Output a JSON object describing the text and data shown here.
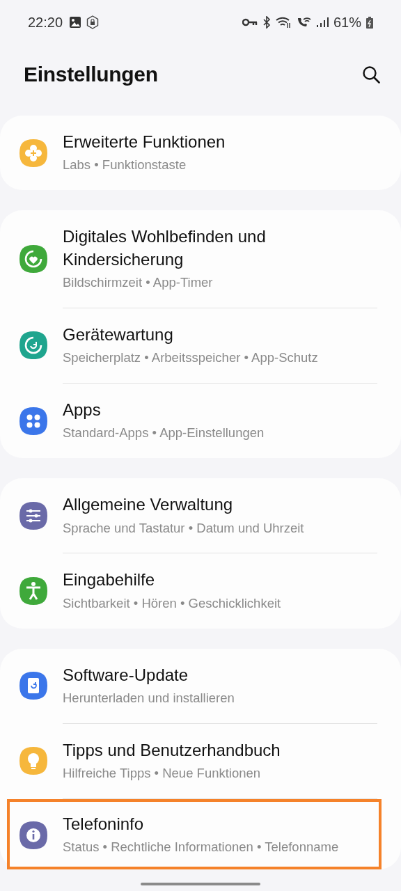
{
  "status_bar": {
    "time": "22:20",
    "battery": "61%"
  },
  "title": "Einstellungen",
  "groups": [
    {
      "items": [
        {
          "kind": "labs",
          "title": "Erweiterte Funktionen",
          "subtitle": "Labs • Funktionstaste",
          "highlighted": false
        }
      ]
    },
    {
      "items": [
        {
          "kind": "wellbeing",
          "title": "Digitales Wohlbefinden und Kindersicherung",
          "subtitle": "Bildschirmzeit • App-Timer",
          "highlighted": false
        },
        {
          "kind": "care",
          "title": "Gerätewartung",
          "subtitle": "Speicherplatz • Arbeitsspeicher • App-Schutz",
          "highlighted": false
        },
        {
          "kind": "apps",
          "title": "Apps",
          "subtitle": "Standard-Apps • App-Einstellungen",
          "highlighted": false
        }
      ]
    },
    {
      "items": [
        {
          "kind": "general",
          "title": "Allgemeine Verwaltung",
          "subtitle": "Sprache und Tastatur • Datum und Uhrzeit",
          "highlighted": false
        },
        {
          "kind": "accessibility",
          "title": "Eingabehilfe",
          "subtitle": "Sichtbarkeit • Hören • Geschicklichkeit",
          "highlighted": false
        }
      ]
    },
    {
      "items": [
        {
          "kind": "update",
          "title": "Software-Update",
          "subtitle": "Herunterladen und installieren",
          "highlighted": false
        },
        {
          "kind": "tips",
          "title": "Tipps und Benutzerhandbuch",
          "subtitle": "Hilfreiche Tipps • Neue Funktionen",
          "highlighted": false
        },
        {
          "kind": "about",
          "title": "Telefoninfo",
          "subtitle": "Status • Rechtliche Informationen • Telefonname",
          "highlighted": true
        }
      ]
    }
  ]
}
